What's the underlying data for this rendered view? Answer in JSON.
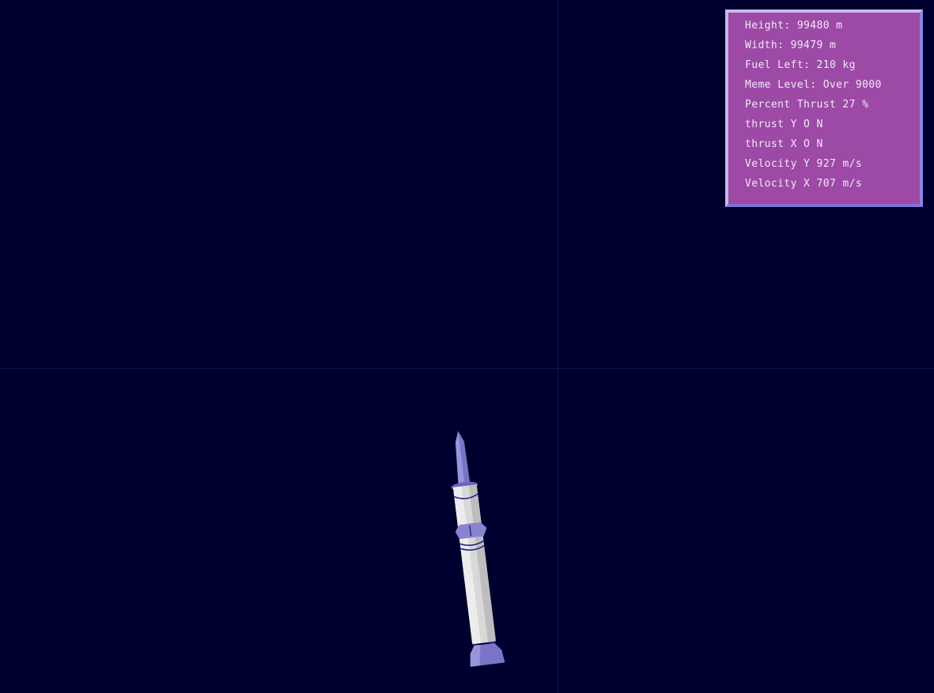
{
  "hud": {
    "height": "Height: 99480 m",
    "width": "Width: 99479 m",
    "fuel_left": "Fuel Left: 210 kg",
    "meme_level": "Meme Level: Over 9000",
    "percent_thrust": "Percent Thrust 27 %",
    "thrust_y": "thrust Y O N",
    "thrust_x": "thrust X O N",
    "velocity_y": "Velocity Y 927 m/s",
    "velocity_x": "Velocity X 707 m/s"
  },
  "colors": {
    "background": "#000030",
    "hud_panel": "#9c4aa6",
    "hud_text": "#f2e8f6",
    "rocket_body": "#d8d8d8",
    "rocket_accent": "#7a74c8"
  }
}
